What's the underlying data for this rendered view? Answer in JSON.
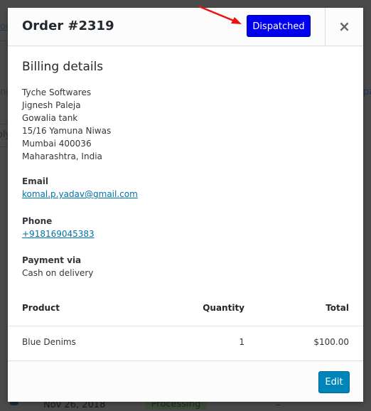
{
  "background": {
    "left_fragments": [
      "oc",
      "ng",
      "oly"
    ],
    "right_fragments": [
      "pa"
    ],
    "row": {
      "date": "Nov 26, 2018",
      "status": "Processing",
      "dash": "–"
    }
  },
  "modal": {
    "title": "Order #2319",
    "status_button": {
      "label": "Dispatched",
      "color": "#0000ee"
    },
    "close_icon": "×",
    "billing": {
      "heading": "Billing details",
      "address_lines": [
        "Tyche Softwares",
        "Jignesh Paleja",
        "Gowalia tank",
        "15/16 Yamuna Niwas",
        "Mumbai 400036",
        "Maharashtra, India"
      ],
      "email_label": "Email",
      "email": "komal.p.yadav@gmail.com",
      "phone_label": "Phone",
      "phone": "+918169045383",
      "payment_label": "Payment via",
      "payment": "Cash on delivery"
    },
    "table": {
      "headers": [
        "Product",
        "Quantity",
        "Total"
      ],
      "rows": [
        {
          "product": "Blue Denims",
          "quantity": "1",
          "total": "$100.00"
        }
      ]
    },
    "footer": {
      "edit_label": "Edit",
      "edit_color": "#0085ba"
    }
  },
  "annotation": {
    "arrow_color": "#ee1111"
  }
}
